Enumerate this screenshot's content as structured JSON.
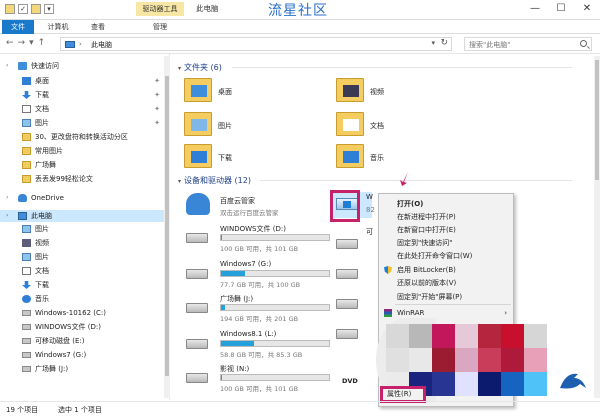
{
  "window": {
    "title": "此电脑",
    "watermark": "流星社区",
    "context_tool": "驱动器工具",
    "controls": [
      "—",
      "☐",
      "✕"
    ]
  },
  "ribbon": {
    "tabs": [
      "文件",
      "计算机",
      "查看",
      "管理"
    ]
  },
  "address": {
    "path": "此电脑",
    "search_placeholder": "搜索\"此电脑\""
  },
  "sidebar": {
    "items": [
      {
        "label": "快速访问",
        "icon": "star-icon",
        "level": 0
      },
      {
        "label": "桌面",
        "icon": "desktop-icon",
        "level": 1,
        "pinned": true
      },
      {
        "label": "下载",
        "icon": "download-icon",
        "level": 1,
        "pinned": true
      },
      {
        "label": "文档",
        "icon": "document-icon",
        "level": 1,
        "pinned": true
      },
      {
        "label": "图片",
        "icon": "pictures-icon",
        "level": 1,
        "pinned": true
      },
      {
        "label": "30、更改盘符和转换活动分区",
        "icon": "folder-icon",
        "level": 1
      },
      {
        "label": "常用图片",
        "icon": "folder-icon",
        "level": 1
      },
      {
        "label": "广场舞",
        "icon": "folder-icon",
        "level": 1
      },
      {
        "label": "丢丢发99轻松论文",
        "icon": "folder-icon",
        "level": 1
      },
      {
        "label": "OneDrive",
        "icon": "cloud-icon",
        "level": 0
      },
      {
        "label": "此电脑",
        "icon": "pc-icon",
        "level": 0,
        "selected": true
      },
      {
        "label": "图片",
        "icon": "pictures-icon",
        "level": 1
      },
      {
        "label": "视频",
        "icon": "video-icon",
        "level": 1
      },
      {
        "label": "图片",
        "icon": "pictures-icon",
        "level": 1
      },
      {
        "label": "文档",
        "icon": "document-icon",
        "level": 1
      },
      {
        "label": "下载",
        "icon": "download-icon",
        "level": 1
      },
      {
        "label": "音乐",
        "icon": "music-icon",
        "level": 1
      },
      {
        "label": "Windows-10162 (C:)",
        "icon": "drive-icon",
        "level": 1
      },
      {
        "label": "WINDOWS文件 (D:)",
        "icon": "drive-icon",
        "level": 1
      },
      {
        "label": "可移动磁盘 (E:)",
        "icon": "drive-icon",
        "level": 1
      },
      {
        "label": "Windows7 (G:)",
        "icon": "drive-icon",
        "level": 1
      },
      {
        "label": "广场舞 (J:)",
        "icon": "drive-icon",
        "level": 1
      }
    ]
  },
  "main": {
    "folders_group": "文件夹 (6)",
    "folders": [
      {
        "label": "桌面",
        "icon": "desktop-folder-icon"
      },
      {
        "label": "视频",
        "icon": "video-folder-icon"
      },
      {
        "label": "图片",
        "icon": "pictures-folder-icon"
      },
      {
        "label": "文档",
        "icon": "documents-folder-icon"
      },
      {
        "label": "下载",
        "icon": "download-folder-icon"
      },
      {
        "label": "音乐",
        "icon": "music-folder-icon"
      }
    ],
    "devices_group": "设备和驱动器 (12)",
    "cloud": {
      "name": "百度云管家",
      "sub": "双击运行百度云管家"
    },
    "drives": [
      {
        "name": "WINDOWS文件 (D:)",
        "size": "100 GB 可用，共 101 GB",
        "used": 0.01
      },
      {
        "name": "Windows7 (G:)",
        "size": "77.7 GB 可用，共 100 GB",
        "used": 0.22
      },
      {
        "name": "广场舞 (J:)",
        "size": "194 GB 可用，共 201 GB",
        "used": 0.04
      },
      {
        "name": "Windows8.1 (L:)",
        "size": "58.8 GB 可用，共 85.3 GB",
        "used": 0.31
      },
      {
        "name": "影视 (N:)",
        "size": "100 GB 可用，共 101 GB",
        "used": 0.01
      }
    ],
    "partial_labels": {
      "w": "W",
      "num": "82",
      "ke": "可",
      "dvd": "DVD"
    }
  },
  "context_menu": {
    "items": [
      {
        "label": "打开(O)",
        "bold": true
      },
      {
        "label": "在新进程中打开(P)"
      },
      {
        "label": "在新窗口中打开(E)"
      },
      {
        "label": "固定到\"快速访问\""
      },
      {
        "label": "在此处打开命令窗口(W)"
      },
      {
        "label": "启用 BitLocker(B)",
        "icon": "shield-icon"
      },
      {
        "label": "还原以前的版本(V)"
      },
      {
        "label": "固定到\"开始\"屏幕(P)"
      },
      {
        "label": "WinRAR",
        "icon": "winrar-icon",
        "submenu": true
      }
    ],
    "last_item": "属性(R)"
  },
  "status": {
    "count": "19 个项目",
    "selected": "选中 1 个项目"
  }
}
